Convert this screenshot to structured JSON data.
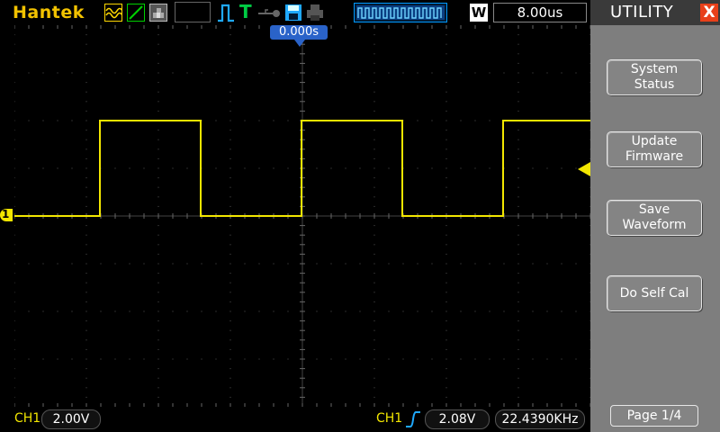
{
  "brand": "Hantek",
  "header": {
    "timebase": "8.00us",
    "window_badge": "W",
    "trigger_position": "0.000s"
  },
  "channel_marker": "1",
  "bottom": {
    "ch1_label": "CH1",
    "ch1_scale": "2.00V",
    "trig_source": "CH1",
    "trig_level": "2.08V",
    "frequency": "22.4390KHz"
  },
  "menu": {
    "title": "UTILITY",
    "close": "X",
    "items": [
      {
        "line1": "System",
        "line2": "Status"
      },
      {
        "line1": "Update",
        "line2": "Firmware"
      },
      {
        "line1": "Save",
        "line2": "Waveform"
      },
      {
        "line1": "Do Self Cal",
        "line2": ""
      }
    ],
    "page": "Page 1/4"
  },
  "icons": {
    "mode_average": "waveform-average-icon",
    "mode_peak": "peak-detect-icon",
    "mode_persist": "persistence-icon",
    "trigger_edge": "pulse-trigger-icon",
    "trigger_status": "trigger-t-icon",
    "usb": "usb-key-icon",
    "save": "floppy-save-icon",
    "print": "printer-icon",
    "trig_slope": "rising-edge-icon"
  },
  "colors": {
    "trace": "#f2e600",
    "brand": "#f2c200",
    "menu_bg": "#7e7e7e",
    "marker_blue": "#2a63c9",
    "close_red": "#e8401a"
  },
  "waveform": {
    "type": "square",
    "low_division": 0,
    "high_division": 2,
    "period_divisions": 2.8,
    "duty_cycle": 0.5
  }
}
